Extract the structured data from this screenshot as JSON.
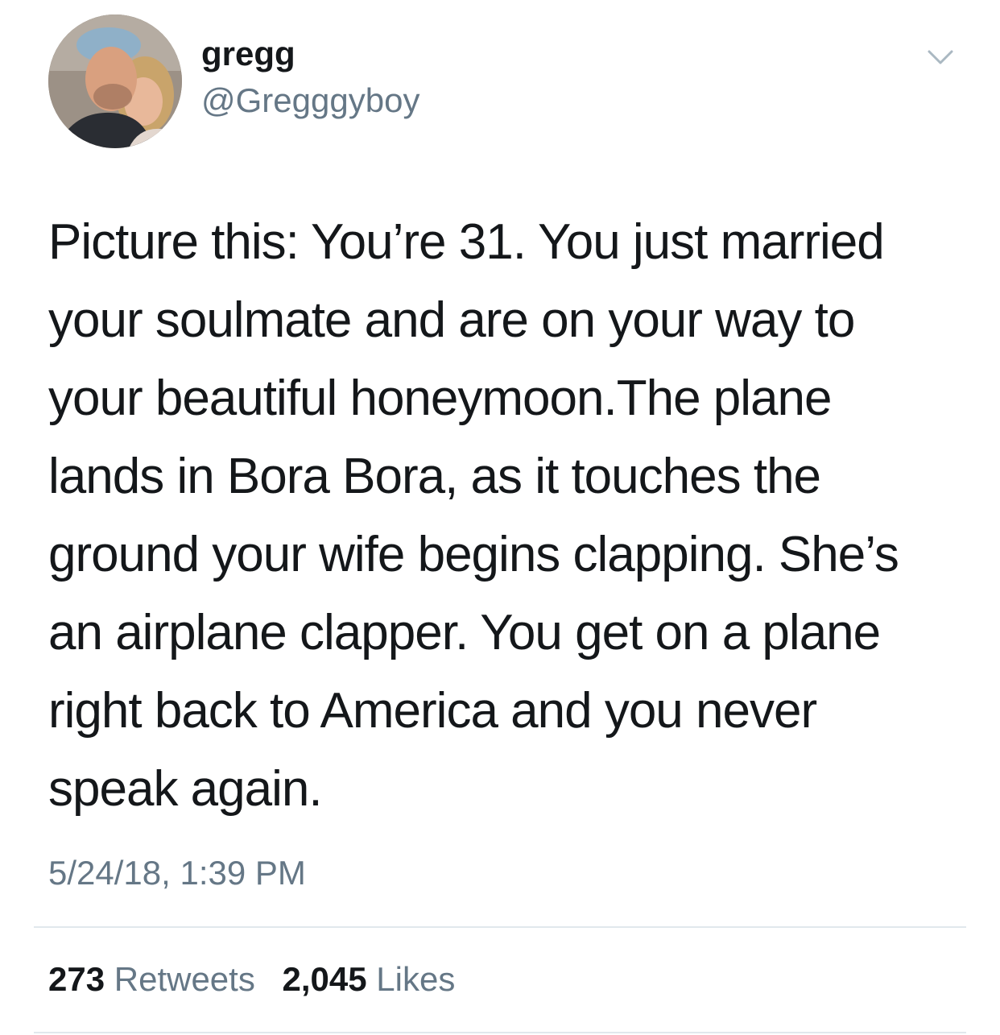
{
  "tweet": {
    "display_name": "gregg",
    "handle": "@Gregggyboy",
    "avatar_icon": "profile-photo",
    "menu_icon": "chevron-down-icon",
    "text": "Picture this: You’re 31. You just married\nyour soulmate and are on your way to\nyour beautiful honeymoon.The plane\nlands in Bora Bora, as it touches the\nground your wife begins clapping. She’s\nan airplane clapper. You get on a plane\nright back to America and you never\nspeak again.",
    "timestamp": "5/24/18, 1:39 PM",
    "stats": {
      "retweets_count": "273",
      "retweets_label": "Retweets",
      "likes_count": "2,045",
      "likes_label": "Likes"
    }
  },
  "colors": {
    "text_primary": "#14171a",
    "text_secondary": "#657786",
    "divider": "#e1e8ed",
    "background": "#ffffff"
  }
}
